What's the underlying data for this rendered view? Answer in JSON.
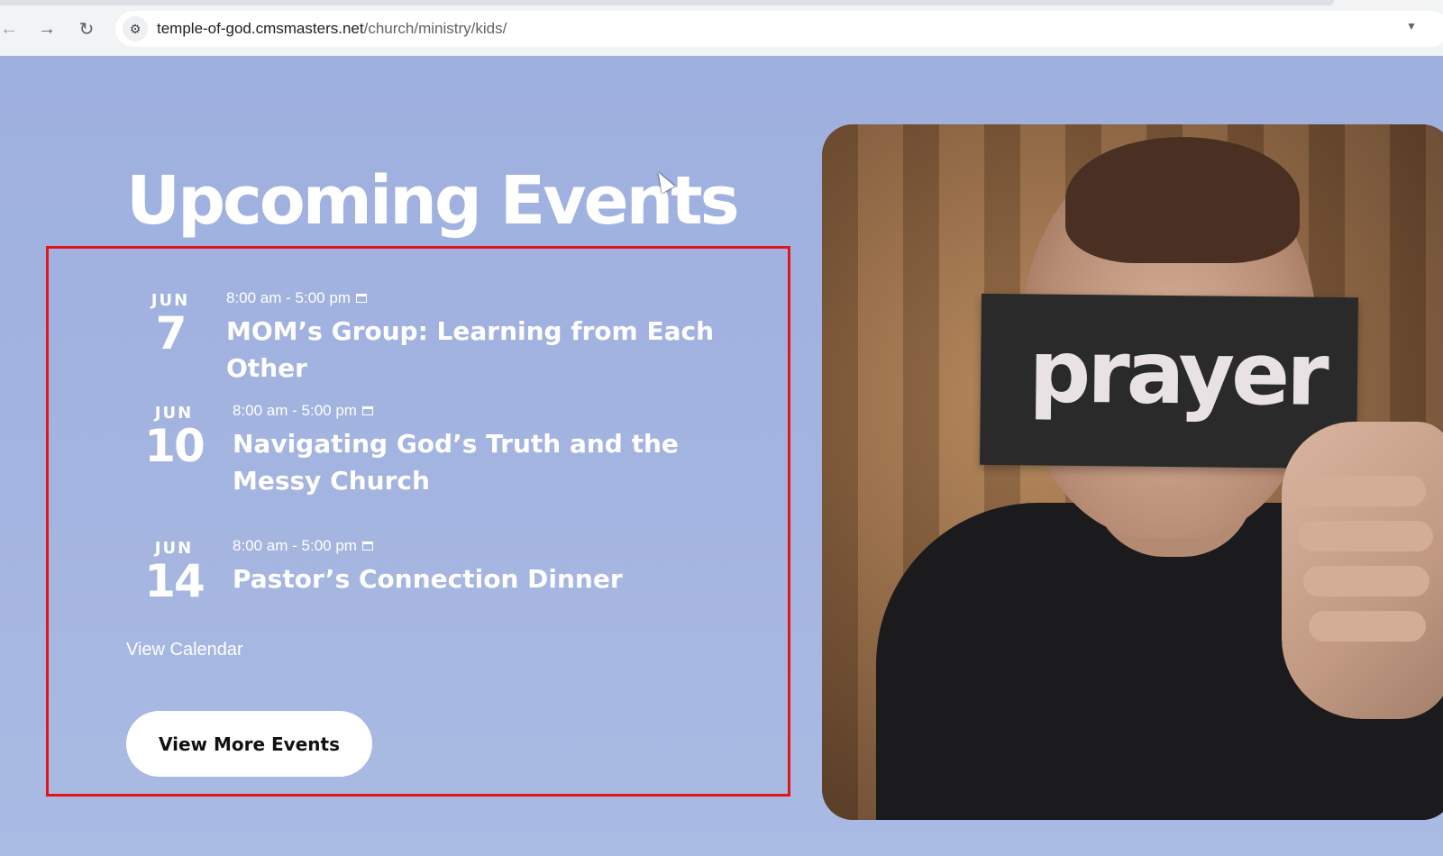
{
  "browser": {
    "url_domain": "temple-of-god.cmsmasters.net",
    "url_path": "/church/ministry/kids/"
  },
  "section": {
    "heading": "Upcoming Events"
  },
  "events": [
    {
      "month": "JUN",
      "day": "7",
      "time": "8:00 am - 5:00 pm",
      "title": "MOM’s Group: Learning from Each Other"
    },
    {
      "month": "JUN",
      "day": "10",
      "time": "8:00 am - 5:00 pm",
      "title": "Navigating God’s Truth and the Messy Church"
    },
    {
      "month": "JUN",
      "day": "14",
      "time": "8:00 am - 5:00 pm",
      "title": "Pastor’s Connection Dinner"
    }
  ],
  "links": {
    "view_calendar": "View Calendar",
    "view_more_events": "View More Events"
  },
  "image": {
    "card_text": "prayer"
  },
  "colors": {
    "background": "#a3b3dd",
    "highlight_border": "#e5141b",
    "button_bg": "#ffffff"
  }
}
